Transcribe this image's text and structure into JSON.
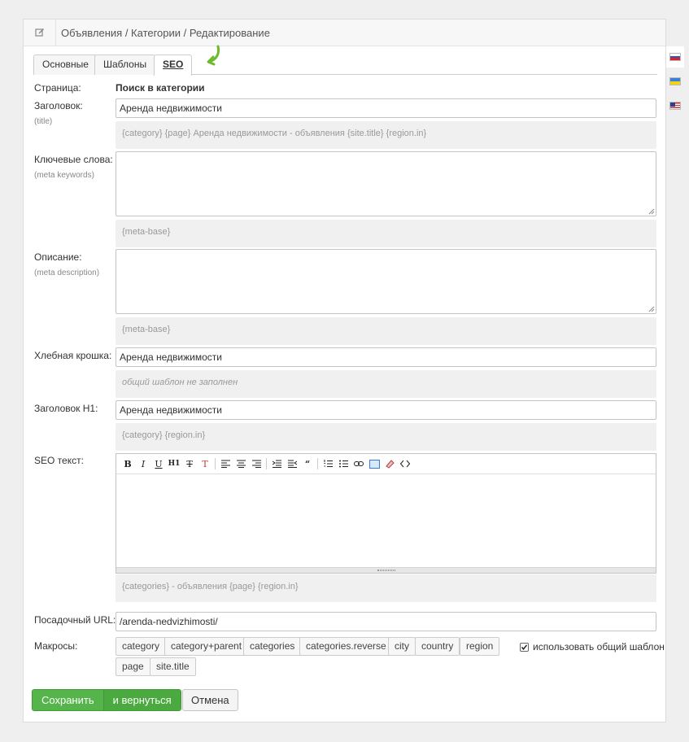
{
  "breadcrumb": {
    "section": "Объявления",
    "category": "Категории",
    "page": "Редактирование",
    "sep": " / "
  },
  "tabs": [
    "Основные",
    "Шаблоны",
    "SEO"
  ],
  "page": {
    "label": "Страница:",
    "value": "Поиск в категории"
  },
  "title_field": {
    "label": "Заголовок:",
    "sub": "(title)",
    "value": "Аренда недвижимости",
    "template": "{category} {page} Аренда недвижимости - объявления {site.title} {region.in}"
  },
  "keywords": {
    "label": "Ключевые слова:",
    "sub": "(meta keywords)",
    "value": "",
    "template": "{meta-base}"
  },
  "description": {
    "label": "Описание:",
    "sub": "(meta description)",
    "value": "",
    "template": "{meta-base}"
  },
  "breadcrumb_field": {
    "label": "Хлебная крошка:",
    "value": "Аренда недвижимости",
    "template": "общий шаблон не заполнен"
  },
  "h1": {
    "label": "Заголовок H1:",
    "value": "Аренда недвижимости",
    "template": "{category} {region.in}"
  },
  "seo_text": {
    "label": "SEO текст:",
    "template": "{categories} - объявления {page} {region.in}"
  },
  "landing_url": {
    "label": "Посадочный URL:",
    "value": "/arenda-nedvizhimosti/"
  },
  "macros": {
    "label": "Макросы:",
    "items": [
      "category",
      "category+parent",
      "categories",
      "categories.reverse",
      "city",
      "country",
      "region",
      "page",
      "site.title"
    ]
  },
  "use_common_template": {
    "label": "использовать общий шаблон",
    "checked": true
  },
  "buttons": {
    "save": "Сохранить",
    "save_return": "и вернуться",
    "cancel": "Отмена"
  },
  "colors": {
    "accent": "#55b54a",
    "arrow": "#6fba2c"
  },
  "languages": [
    "ru-flag-icon",
    "ua-flag-icon",
    "en-flag-icon"
  ]
}
